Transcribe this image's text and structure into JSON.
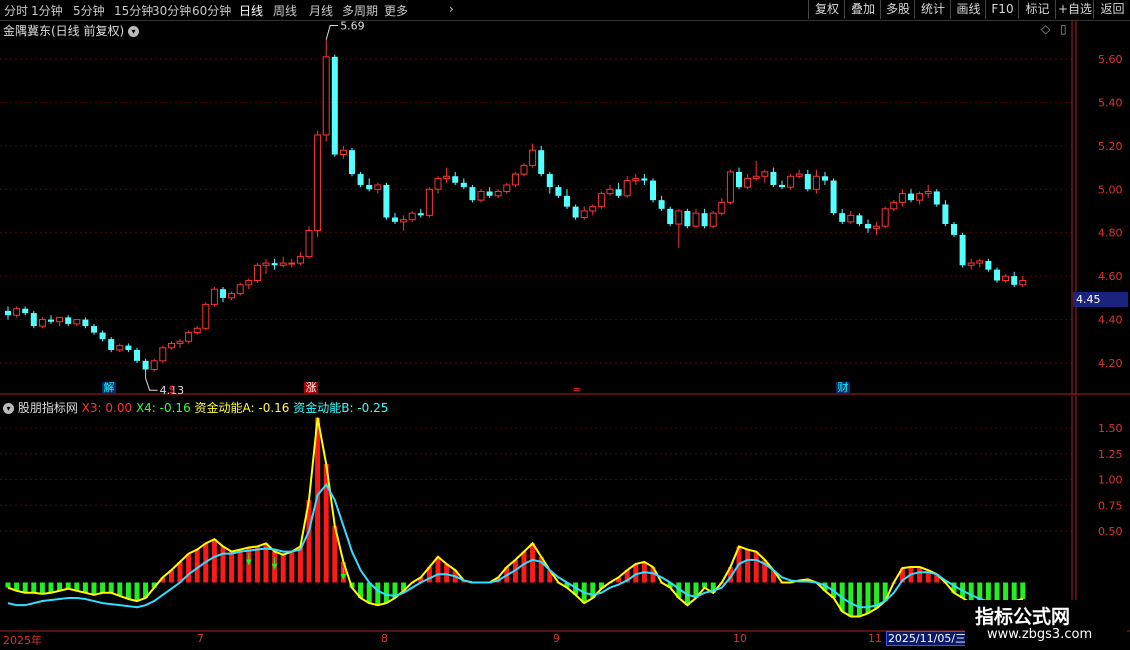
{
  "toolbar": {
    "periods": [
      "分时",
      "1分钟",
      "5分钟",
      "15分钟",
      "30分钟",
      "60分钟",
      "日线",
      "周线",
      "月线",
      "多周期",
      "更多"
    ],
    "active": "日线",
    "right_buttons": [
      "复权",
      "叠加",
      "多股",
      "统计",
      "画线",
      "F10",
      "标记",
      "+自选",
      "返回"
    ]
  },
  "main_panel": {
    "title": "金隅冀东(日线 前复权)",
    "y_ticks": [
      "5.60",
      "5.40",
      "5.20",
      "5.00",
      "4.80",
      "4.60",
      "4.40",
      "4.20"
    ],
    "current_price": "4.45",
    "high_label": "5.69",
    "low_label": "4.13",
    "events": [
      {
        "text": "解",
        "color": "#00ffff",
        "bg": "#0a2a6a"
      },
      {
        "text": "$",
        "color": "#ff3333",
        "bg": "none"
      },
      {
        "text": "涨",
        "color": "#ffffff",
        "bg": "#aa0000"
      },
      {
        "text": "≈",
        "color": "#ff3333",
        "bg": "none"
      },
      {
        "text": "财",
        "color": "#00ffff",
        "bg": "#0a2a6a"
      }
    ]
  },
  "indicator_panel": {
    "name": "股朋指标网",
    "x3_label": "X3: 0.00",
    "x4_label": "X4: -0.16",
    "a_label": "资金动能A: -0.16",
    "b_label": "资金动能B: -0.25",
    "y_ticks": [
      "1.50",
      "1.25",
      "1.00",
      "0.75",
      "0.50"
    ]
  },
  "x_axis": {
    "labels": [
      "2025年",
      "7",
      "8",
      "9",
      "10",
      "11"
    ],
    "cursor_date": "2025/11/05/三"
  },
  "watermark": {
    "title": "指标公式网",
    "url": "www.zbgs3.com"
  },
  "colors": {
    "up": "#ff3333",
    "down": "#54ffff",
    "grid": "#5a0000",
    "axis": "#aa2222"
  },
  "chart_data": {
    "type": "candlestick",
    "ohlc": [
      [
        4.44,
        4.46,
        4.4,
        4.42
      ],
      [
        4.42,
        4.46,
        4.41,
        4.45
      ],
      [
        4.45,
        4.46,
        4.42,
        4.43
      ],
      [
        4.43,
        4.44,
        4.36,
        4.37
      ],
      [
        4.37,
        4.41,
        4.36,
        4.4
      ],
      [
        4.4,
        4.42,
        4.38,
        4.39
      ],
      [
        4.39,
        4.41,
        4.37,
        4.41
      ],
      [
        4.41,
        4.42,
        4.37,
        4.38
      ],
      [
        4.38,
        4.4,
        4.37,
        4.4
      ],
      [
        4.4,
        4.41,
        4.36,
        4.37
      ],
      [
        4.37,
        4.38,
        4.33,
        4.34
      ],
      [
        4.34,
        4.35,
        4.3,
        4.31
      ],
      [
        4.31,
        4.32,
        4.25,
        4.26
      ],
      [
        4.26,
        4.29,
        4.25,
        4.28
      ],
      [
        4.28,
        4.29,
        4.25,
        4.26
      ],
      [
        4.26,
        4.27,
        4.2,
        4.21
      ],
      [
        4.21,
        4.22,
        4.13,
        4.17
      ],
      [
        4.17,
        4.22,
        4.16,
        4.21
      ],
      [
        4.21,
        4.28,
        4.2,
        4.27
      ],
      [
        4.27,
        4.3,
        4.26,
        4.29
      ],
      [
        4.29,
        4.31,
        4.27,
        4.3
      ],
      [
        4.3,
        4.35,
        4.29,
        4.34
      ],
      [
        4.34,
        4.37,
        4.33,
        4.36
      ],
      [
        4.36,
        4.48,
        4.35,
        4.47
      ],
      [
        4.47,
        4.55,
        4.46,
        4.54
      ],
      [
        4.54,
        4.55,
        4.48,
        4.5
      ],
      [
        4.5,
        4.53,
        4.49,
        4.52
      ],
      [
        4.52,
        4.57,
        4.51,
        4.56
      ],
      [
        4.56,
        4.59,
        4.54,
        4.58
      ],
      [
        4.58,
        4.66,
        4.57,
        4.65
      ],
      [
        4.65,
        4.68,
        4.61,
        4.66
      ],
      [
        4.66,
        4.68,
        4.63,
        4.65
      ],
      [
        4.65,
        4.69,
        4.64,
        4.66
      ],
      [
        4.66,
        4.68,
        4.64,
        4.66
      ],
      [
        4.66,
        4.71,
        4.65,
        4.69
      ],
      [
        4.69,
        4.83,
        4.68,
        4.81
      ],
      [
        4.81,
        5.27,
        4.78,
        5.25
      ],
      [
        5.25,
        5.69,
        5.22,
        5.61
      ],
      [
        5.61,
        5.62,
        5.15,
        5.16
      ],
      [
        5.16,
        5.2,
        5.14,
        5.18
      ],
      [
        5.18,
        5.19,
        5.06,
        5.07
      ],
      [
        5.07,
        5.08,
        5.01,
        5.02
      ],
      [
        5.02,
        5.05,
        4.99,
        5.0
      ],
      [
        5.0,
        5.03,
        4.98,
        5.02
      ],
      [
        5.02,
        5.03,
        4.86,
        4.87
      ],
      [
        4.87,
        4.89,
        4.84,
        4.85
      ],
      [
        4.85,
        4.88,
        4.81,
        4.86
      ],
      [
        4.86,
        4.9,
        4.85,
        4.89
      ],
      [
        4.89,
        4.91,
        4.87,
        4.88
      ],
      [
        4.88,
        5.01,
        4.87,
        5.0
      ],
      [
        5.0,
        5.06,
        4.98,
        5.05
      ],
      [
        5.05,
        5.1,
        5.03,
        5.06
      ],
      [
        5.06,
        5.08,
        5.02,
        5.03
      ],
      [
        5.03,
        5.05,
        5.0,
        5.01
      ],
      [
        5.01,
        5.02,
        4.94,
        4.95
      ],
      [
        4.95,
        5.0,
        4.94,
        4.99
      ],
      [
        4.99,
        5.01,
        4.96,
        4.97
      ],
      [
        4.97,
        5.0,
        4.96,
        4.99
      ],
      [
        4.99,
        5.03,
        4.98,
        5.02
      ],
      [
        5.02,
        5.08,
        5.01,
        5.07
      ],
      [
        5.07,
        5.12,
        5.06,
        5.11
      ],
      [
        5.11,
        5.21,
        5.1,
        5.18
      ],
      [
        5.18,
        5.2,
        5.06,
        5.07
      ],
      [
        5.07,
        5.08,
        4.98,
        5.01
      ],
      [
        5.01,
        5.02,
        4.96,
        4.97
      ],
      [
        4.97,
        5.0,
        4.91,
        4.92
      ],
      [
        4.92,
        4.93,
        4.86,
        4.87
      ],
      [
        4.87,
        4.92,
        4.86,
        4.9
      ],
      [
        4.9,
        4.93,
        4.88,
        4.92
      ],
      [
        4.92,
        4.99,
        4.91,
        4.98
      ],
      [
        4.98,
        5.02,
        4.97,
        5.0
      ],
      [
        5.0,
        5.03,
        4.96,
        4.97
      ],
      [
        4.97,
        5.06,
        4.96,
        5.04
      ],
      [
        5.04,
        5.07,
        5.02,
        5.05
      ],
      [
        5.05,
        5.07,
        5.02,
        5.04
      ],
      [
        5.04,
        5.05,
        4.94,
        4.95
      ],
      [
        4.95,
        4.97,
        4.9,
        4.91
      ],
      [
        4.91,
        4.92,
        4.83,
        4.84
      ],
      [
        4.84,
        4.91,
        4.73,
        4.9
      ],
      [
        4.9,
        4.91,
        4.82,
        4.83
      ],
      [
        4.83,
        4.91,
        4.82,
        4.89
      ],
      [
        4.89,
        4.91,
        4.82,
        4.83
      ],
      [
        4.83,
        4.9,
        4.82,
        4.89
      ],
      [
        4.89,
        4.96,
        4.88,
        4.94
      ],
      [
        4.94,
        5.09,
        4.93,
        5.08
      ],
      [
        5.08,
        5.1,
        5.0,
        5.01
      ],
      [
        5.01,
        5.07,
        5.0,
        5.05
      ],
      [
        5.05,
        5.13,
        5.04,
        5.06
      ],
      [
        5.06,
        5.09,
        5.03,
        5.08
      ],
      [
        5.08,
        5.1,
        5.01,
        5.02
      ],
      [
        5.02,
        5.04,
        5.0,
        5.01
      ],
      [
        5.01,
        5.07,
        5.0,
        5.06
      ],
      [
        5.06,
        5.09,
        5.05,
        5.07
      ],
      [
        5.07,
        5.09,
        4.99,
        5.0
      ],
      [
        5.0,
        5.09,
        4.98,
        5.06
      ],
      [
        5.06,
        5.08,
        5.02,
        5.04
      ],
      [
        5.04,
        5.05,
        4.88,
        4.89
      ],
      [
        4.89,
        4.91,
        4.84,
        4.85
      ],
      [
        4.85,
        4.9,
        4.84,
        4.88
      ],
      [
        4.88,
        4.89,
        4.83,
        4.84
      ],
      [
        4.84,
        4.86,
        4.8,
        4.82
      ],
      [
        4.82,
        4.85,
        4.79,
        4.83
      ],
      [
        4.83,
        4.92,
        4.82,
        4.91
      ],
      [
        4.91,
        4.95,
        4.9,
        4.94
      ],
      [
        4.94,
        5.0,
        4.92,
        4.98
      ],
      [
        4.98,
        5.0,
        4.94,
        4.95
      ],
      [
        4.95,
        4.99,
        4.93,
        4.98
      ],
      [
        4.98,
        5.02,
        4.96,
        4.99
      ],
      [
        4.99,
        5.0,
        4.92,
        4.93
      ],
      [
        4.93,
        4.95,
        4.83,
        4.84
      ],
      [
        4.84,
        4.85,
        4.78,
        4.79
      ],
      [
        4.79,
        4.8,
        4.64,
        4.65
      ],
      [
        4.65,
        4.68,
        4.63,
        4.66
      ],
      [
        4.66,
        4.68,
        4.64,
        4.67
      ],
      [
        4.67,
        4.68,
        4.62,
        4.63
      ],
      [
        4.63,
        4.64,
        4.57,
        4.58
      ],
      [
        4.58,
        4.61,
        4.57,
        4.6
      ],
      [
        4.6,
        4.62,
        4.55,
        4.56
      ],
      [
        4.56,
        4.6,
        4.55,
        4.58
      ]
    ],
    "indicator": {
      "x3": [
        -0.05,
        -0.08,
        -0.1,
        -0.1,
        -0.11,
        -0.1,
        -0.08,
        -0.06,
        -0.08,
        -0.1,
        -0.12,
        -0.1,
        -0.1,
        -0.13,
        -0.16,
        -0.18,
        -0.15,
        -0.05,
        0.05,
        0.12,
        0.2,
        0.28,
        0.32,
        0.38,
        0.42,
        0.35,
        0.3,
        0.32,
        0.34,
        0.35,
        0.38,
        0.3,
        0.27,
        0.3,
        0.35,
        0.8,
        1.6,
        1.15,
        0.55,
        0.2,
        -0.05,
        -0.15,
        -0.2,
        -0.22,
        -0.2,
        -0.15,
        -0.08,
        0.0,
        0.05,
        0.15,
        0.25,
        0.18,
        0.12,
        0.02,
        0.0,
        0.0,
        0.0,
        0.05,
        0.15,
        0.22,
        0.3,
        0.38,
        0.25,
        0.12,
        0.0,
        -0.05,
        -0.12,
        -0.2,
        -0.15,
        -0.06,
        0.0,
        0.05,
        0.12,
        0.18,
        0.2,
        0.15,
        0.0,
        -0.05,
        -0.15,
        -0.22,
        -0.15,
        -0.05,
        -0.1,
        0.0,
        0.15,
        0.35,
        0.32,
        0.3,
        0.22,
        0.12,
        0.0,
        0.0,
        0.02,
        0.03,
        0.0,
        -0.08,
        -0.15,
        -0.28,
        -0.33,
        -0.33,
        -0.3,
        -0.25,
        -0.18,
        0.0,
        0.14,
        0.15,
        0.15,
        0.12,
        0.08,
        0.0,
        -0.1,
        -0.15,
        -0.2,
        -0.22,
        -0.2,
        -0.18,
        -0.2,
        -0.18,
        -0.16
      ],
      "b": [
        -0.2,
        -0.22,
        -0.22,
        -0.2,
        -0.18,
        -0.17,
        -0.16,
        -0.15,
        -0.15,
        -0.16,
        -0.18,
        -0.2,
        -0.21,
        -0.22,
        -0.23,
        -0.24,
        -0.22,
        -0.18,
        -0.12,
        -0.06,
        0.0,
        0.08,
        0.14,
        0.2,
        0.25,
        0.28,
        0.28,
        0.3,
        0.31,
        0.32,
        0.33,
        0.32,
        0.3,
        0.3,
        0.32,
        0.5,
        0.85,
        0.95,
        0.8,
        0.55,
        0.3,
        0.12,
        0.0,
        -0.08,
        -0.12,
        -0.13,
        -0.1,
        -0.05,
        0.0,
        0.04,
        0.08,
        0.08,
        0.06,
        0.02,
        0.0,
        0.0,
        0.0,
        0.02,
        0.07,
        0.12,
        0.18,
        0.22,
        0.2,
        0.12,
        0.05,
        0.0,
        -0.05,
        -0.1,
        -0.12,
        -0.1,
        -0.05,
        -0.02,
        0.02,
        0.08,
        0.1,
        0.09,
        0.05,
        0.0,
        -0.06,
        -0.12,
        -0.14,
        -0.1,
        -0.08,
        -0.05,
        0.05,
        0.18,
        0.22,
        0.22,
        0.18,
        0.12,
        0.05,
        0.02,
        0.01,
        0.01,
        0.0,
        -0.03,
        -0.08,
        -0.15,
        -0.2,
        -0.24,
        -0.24,
        -0.22,
        -0.18,
        -0.1,
        0.02,
        0.08,
        0.1,
        0.1,
        0.08,
        0.02,
        -0.03,
        -0.08,
        -0.12,
        -0.16,
        -0.18,
        -0.2,
        -0.21,
        -0.22,
        -0.25
      ]
    }
  }
}
